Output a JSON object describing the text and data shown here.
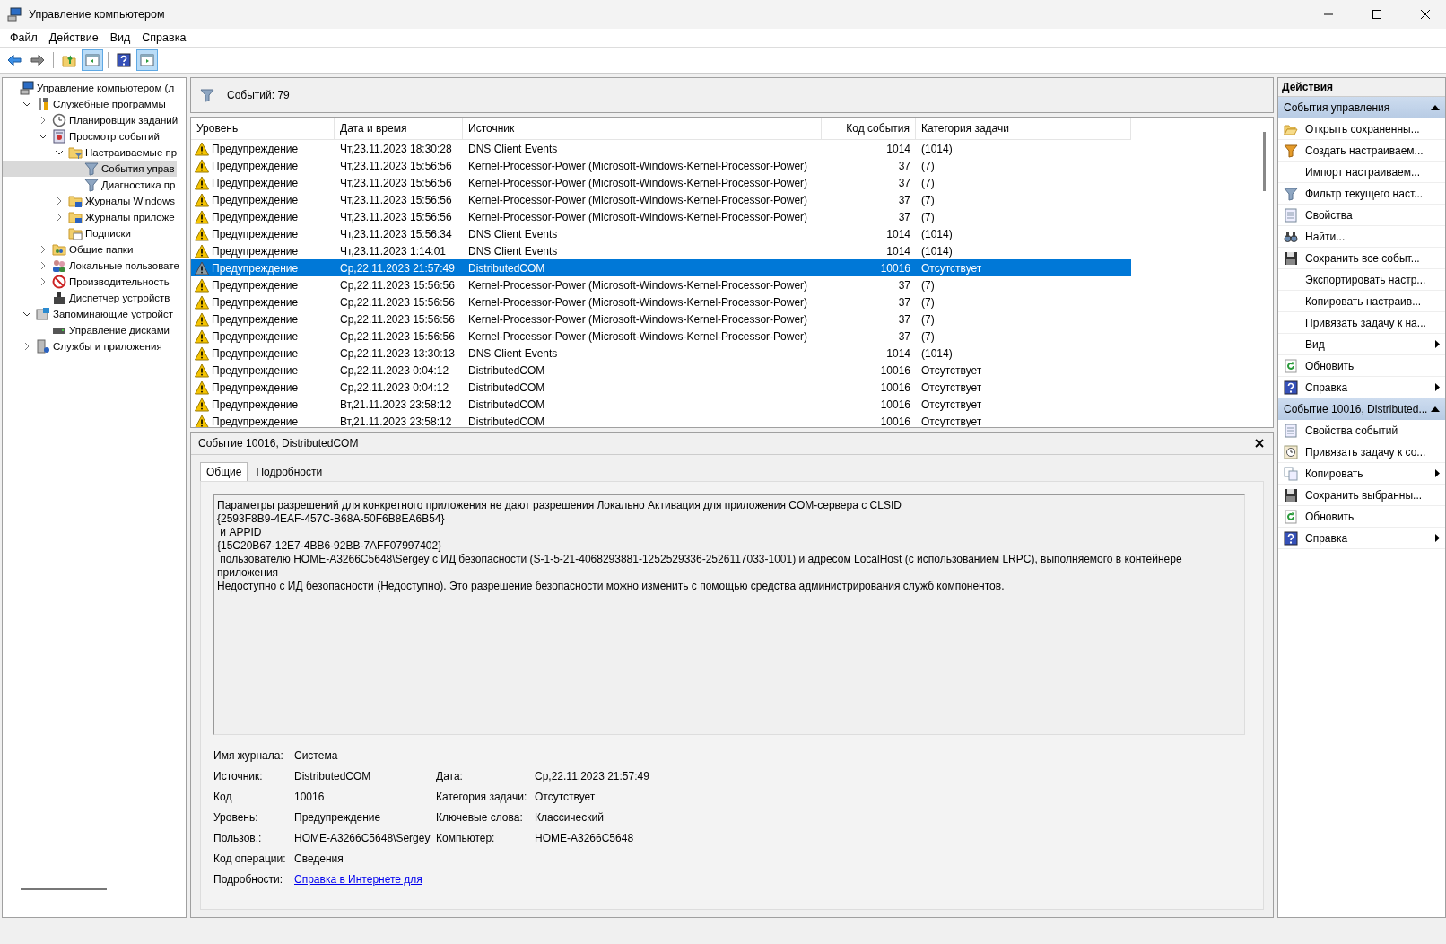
{
  "window": {
    "title": "Управление компьютером"
  },
  "menu": [
    "Файл",
    "Действие",
    "Вид",
    "Справка"
  ],
  "toolbar": [
    [
      {
        "kind": "back",
        "pressed": false
      },
      {
        "kind": "forward",
        "pressed": false
      }
    ],
    [
      {
        "kind": "up",
        "pressed": false
      },
      {
        "kind": "tree-pane",
        "pressed": true
      }
    ],
    [
      {
        "kind": "help",
        "pressed": false
      },
      {
        "kind": "action-pane",
        "pressed": true
      }
    ]
  ],
  "tree": [
    {
      "label": "Управление компьютером (л",
      "kind": "computer",
      "selected": false,
      "children": [
        {
          "label": "Служебные программы",
          "kind": "tools",
          "expanded": true,
          "selected": false,
          "children": [
            {
              "label": "Планировщик заданий",
              "kind": "clock",
              "expanded": false,
              "selected": false
            },
            {
              "label": "Просмотр событий",
              "kind": "log",
              "expanded": true,
              "selected": false,
              "children": [
                {
                  "label": "Настраиваемые пр",
                  "kind": "folder-filter",
                  "expanded": true,
                  "selected": false,
                  "children": [
                    {
                      "label": "События управ",
                      "kind": "filter",
                      "selected": true
                    },
                    {
                      "label": "Диагностика пр",
                      "kind": "filter",
                      "selected": false
                    }
                  ]
                },
                {
                  "label": "Журналы Windows",
                  "kind": "folder-window",
                  "expanded": false,
                  "selected": false
                },
                {
                  "label": "Журналы приложе",
                  "kind": "folder-window",
                  "expanded": false,
                  "selected": false
                },
                {
                  "label": "Подписки",
                  "kind": "folder-doc",
                  "selected": false
                }
              ]
            },
            {
              "label": "Общие папки",
              "kind": "shared",
              "expanded": false,
              "selected": false
            },
            {
              "label": "Локальные пользовате",
              "kind": "users",
              "expanded": false,
              "selected": false
            },
            {
              "label": "Производительность",
              "kind": "perf",
              "expanded": false,
              "selected": false
            },
            {
              "label": "Диспетчер устройств",
              "kind": "device",
              "selected": false
            }
          ]
        },
        {
          "label": "Запоминающие устройст",
          "kind": "storage",
          "expanded": true,
          "selected": false,
          "children": [
            {
              "label": "Управление дисками",
              "kind": "disk",
              "selected": false
            }
          ]
        },
        {
          "label": "Службы и приложения",
          "kind": "services",
          "expanded": false,
          "selected": false
        }
      ]
    }
  ],
  "events": {
    "count": "Событий: 79",
    "columns": [
      "Уровень",
      "Дата и время",
      "Источник",
      "Код события",
      "Категория задачи"
    ],
    "rows": [
      {
        "level": "Предупреждение",
        "datetime": "Чт,23.11.2023 18:30:28",
        "source": "DNS Client Events",
        "code": "1014",
        "category": "(1014)",
        "selected": false
      },
      {
        "level": "Предупреждение",
        "datetime": "Чт,23.11.2023 15:56:56",
        "source": "Kernel-Processor-Power (Microsoft-Windows-Kernel-Processor-Power)",
        "code": "37",
        "category": "(7)",
        "selected": false
      },
      {
        "level": "Предупреждение",
        "datetime": "Чт,23.11.2023 15:56:56",
        "source": "Kernel-Processor-Power (Microsoft-Windows-Kernel-Processor-Power)",
        "code": "37",
        "category": "(7)",
        "selected": false
      },
      {
        "level": "Предупреждение",
        "datetime": "Чт,23.11.2023 15:56:56",
        "source": "Kernel-Processor-Power (Microsoft-Windows-Kernel-Processor-Power)",
        "code": "37",
        "category": "(7)",
        "selected": false
      },
      {
        "level": "Предупреждение",
        "datetime": "Чт,23.11.2023 15:56:56",
        "source": "Kernel-Processor-Power (Microsoft-Windows-Kernel-Processor-Power)",
        "code": "37",
        "category": "(7)",
        "selected": false
      },
      {
        "level": "Предупреждение",
        "datetime": "Чт,23.11.2023 15:56:34",
        "source": "DNS Client Events",
        "code": "1014",
        "category": "(1014)",
        "selected": false
      },
      {
        "level": "Предупреждение",
        "datetime": "Чт,23.11.2023 1:14:01",
        "source": "DNS Client Events",
        "code": "1014",
        "category": "(1014)",
        "selected": false
      },
      {
        "level": "Предупреждение",
        "datetime": "Ср,22.11.2023 21:57:49",
        "source": "DistributedCOM",
        "code": "10016",
        "category": "Отсутствует",
        "selected": true
      },
      {
        "level": "Предупреждение",
        "datetime": "Ср,22.11.2023 15:56:56",
        "source": "Kernel-Processor-Power (Microsoft-Windows-Kernel-Processor-Power)",
        "code": "37",
        "category": "(7)",
        "selected": false
      },
      {
        "level": "Предупреждение",
        "datetime": "Ср,22.11.2023 15:56:56",
        "source": "Kernel-Processor-Power (Microsoft-Windows-Kernel-Processor-Power)",
        "code": "37",
        "category": "(7)",
        "selected": false
      },
      {
        "level": "Предупреждение",
        "datetime": "Ср,22.11.2023 15:56:56",
        "source": "Kernel-Processor-Power (Microsoft-Windows-Kernel-Processor-Power)",
        "code": "37",
        "category": "(7)",
        "selected": false
      },
      {
        "level": "Предупреждение",
        "datetime": "Ср,22.11.2023 15:56:56",
        "source": "Kernel-Processor-Power (Microsoft-Windows-Kernel-Processor-Power)",
        "code": "37",
        "category": "(7)",
        "selected": false
      },
      {
        "level": "Предупреждение",
        "datetime": "Ср,22.11.2023 13:30:13",
        "source": "DNS Client Events",
        "code": "1014",
        "category": "(1014)",
        "selected": false
      },
      {
        "level": "Предупреждение",
        "datetime": "Ср,22.11.2023 0:04:12",
        "source": "DistributedCOM",
        "code": "10016",
        "category": "Отсутствует",
        "selected": false
      },
      {
        "level": "Предупреждение",
        "datetime": "Ср,22.11.2023 0:04:12",
        "source": "DistributedCOM",
        "code": "10016",
        "category": "Отсутствует",
        "selected": false
      },
      {
        "level": "Предупреждение",
        "datetime": "Вт,21.11.2023 23:58:12",
        "source": "DistributedCOM",
        "code": "10016",
        "category": "Отсутствует",
        "selected": false
      },
      {
        "level": "Предупреждение",
        "datetime": "Вт,21.11.2023 23:58:12",
        "source": "DistributedCOM",
        "code": "10016",
        "category": "Отсутствует",
        "selected": false
      }
    ]
  },
  "detail": {
    "title": "Событие 10016, DistributedCOM",
    "tabs": [
      {
        "label": "Общие",
        "selected": true
      },
      {
        "label": "Подробности",
        "selected": false
      }
    ],
    "description": "Параметры разрешений для конкретного приложения не дают разрешения Локально Активация для приложения COM-сервера с CLSID\n{2593F8B9-4EAF-457C-B68A-50F6B8EA6B54}\n и APPID\n{15C20B67-12E7-4BB6-92BB-7AFF07997402}\n пользователю HOME-A3266C5648\\Sergey с ИД безопасности (S-1-5-21-4068293881-1252529336-2526117033-1001) и адресом LocalHost (с использованием LRPC), выполняемого в контейнере приложения\nНедоступно с ИД безопасности (Недоступно). Это разрешение безопасности можно изменить с помощью средства администрирования служб компонентов.",
    "fields": [
      [
        {
          "label": "Имя журнала:",
          "value": "Система",
          "kind": "text"
        }
      ],
      [
        {
          "label": "Источник:",
          "value": "DistributedCOM",
          "kind": "text"
        },
        {
          "label": "Дата:",
          "value": "Ср,22.11.2023 21:57:49",
          "kind": "text"
        }
      ],
      [
        {
          "label": "Код",
          "value": "10016",
          "kind": "text"
        },
        {
          "label": "Категория задачи:",
          "value": "Отсутствует",
          "kind": "text"
        }
      ],
      [
        {
          "label": "Уровень:",
          "value": "Предупреждение",
          "kind": "text"
        },
        {
          "label": "Ключевые слова:",
          "value": "Классический",
          "kind": "text"
        }
      ],
      [
        {
          "label": "Пользов.:",
          "value": "HOME-A3266C5648\\Sergey",
          "kind": "text"
        },
        {
          "label": "Компьютер:",
          "value": "HOME-A3266C5648",
          "kind": "text"
        }
      ],
      [
        {
          "label": "Код операции:",
          "value": "Сведения",
          "kind": "text"
        }
      ],
      [
        {
          "label": "Подробности:",
          "value": "Справка в Интернете для",
          "kind": "link"
        }
      ]
    ]
  },
  "actions": {
    "title": "Действия",
    "sections": [
      {
        "title": "События управления",
        "expanded": true,
        "items": [
          {
            "label": "Открыть сохраненны...",
            "kind": "open-folder",
            "submenu": false
          },
          {
            "label": "Создать настраиваем...",
            "kind": "filter-create",
            "submenu": false
          },
          {
            "label": "Импорт настраиваем...",
            "kind": "plain",
            "submenu": false
          },
          {
            "label": "Фильтр текущего наст...",
            "kind": "filter",
            "submenu": false
          },
          {
            "label": "Свойства",
            "kind": "properties",
            "submenu": false
          },
          {
            "label": "Найти...",
            "kind": "find",
            "submenu": false
          },
          {
            "label": "Сохранить все событ...",
            "kind": "save",
            "submenu": false
          },
          {
            "label": "Экспортировать настр...",
            "kind": "plain",
            "submenu": false
          },
          {
            "label": "Копировать настраив...",
            "kind": "plain",
            "submenu": false
          },
          {
            "label": "Привязать задачу к на...",
            "kind": "plain",
            "submenu": false
          },
          {
            "label": "Вид",
            "kind": "plain",
            "submenu": true
          },
          {
            "label": "Обновить",
            "kind": "refresh",
            "submenu": false
          },
          {
            "label": "Справка",
            "kind": "help",
            "submenu": true
          }
        ]
      },
      {
        "title": "Событие 10016, Distributed...",
        "expanded": true,
        "items": [
          {
            "label": "Свойства событий",
            "kind": "properties",
            "submenu": false
          },
          {
            "label": "Привязать задачу к со...",
            "kind": "task",
            "submenu": false
          },
          {
            "label": "Копировать",
            "kind": "copy",
            "submenu": true
          },
          {
            "label": "Сохранить выбранны...",
            "kind": "save",
            "submenu": false
          },
          {
            "label": "Обновить",
            "kind": "refresh",
            "submenu": false
          },
          {
            "label": "Справка",
            "kind": "help",
            "submenu": true
          }
        ]
      }
    ]
  }
}
